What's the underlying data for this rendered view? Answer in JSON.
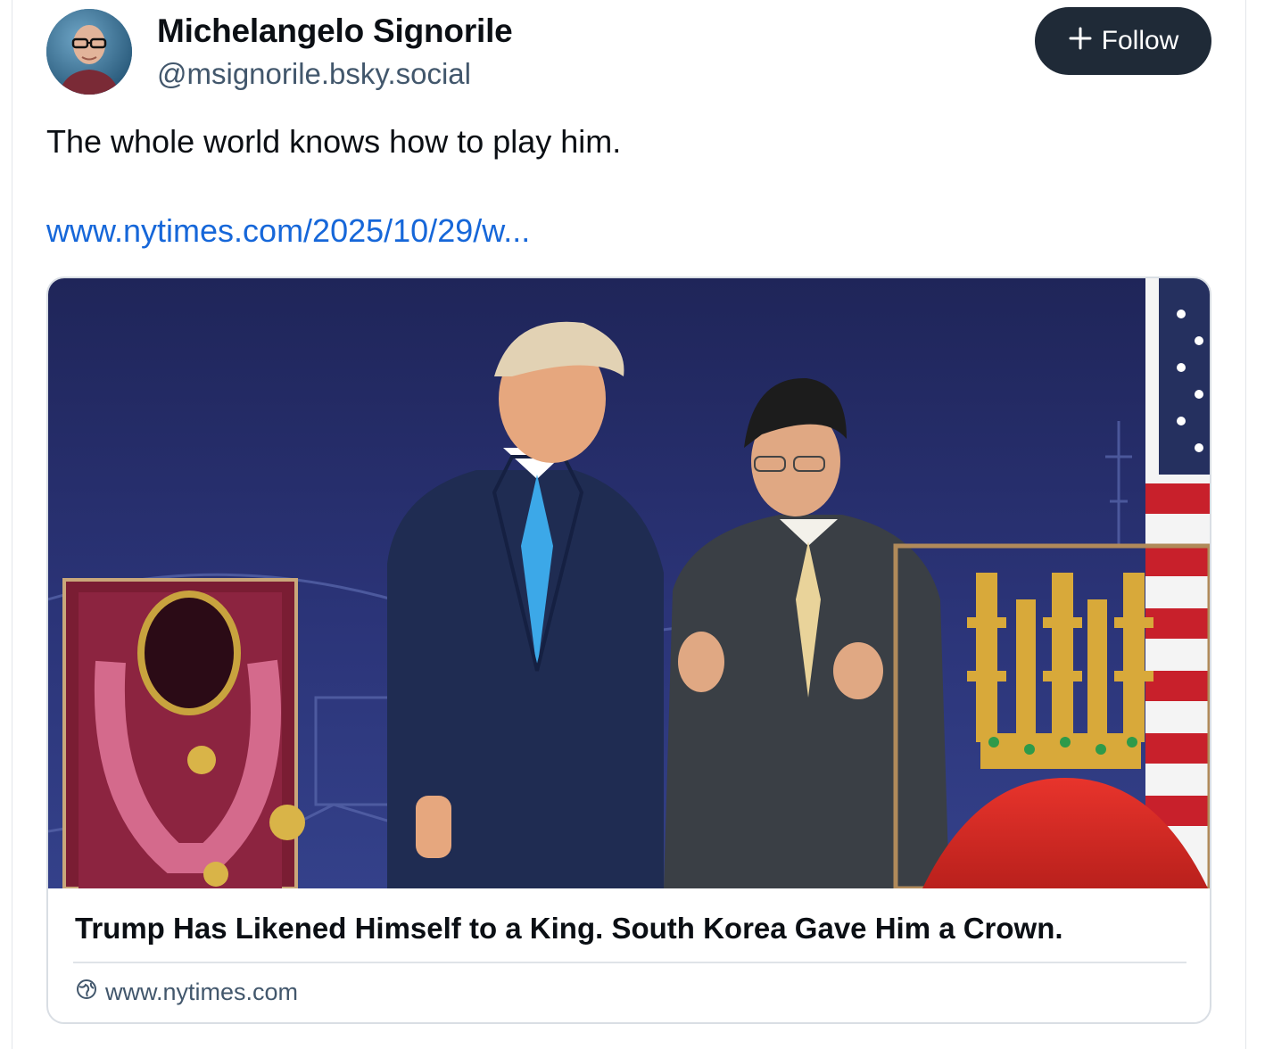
{
  "author": {
    "name": "Michelangelo Signorile",
    "handle": "@msignorile.bsky.social"
  },
  "follow_button": {
    "icon": "plus-icon",
    "label": "Follow"
  },
  "post": {
    "text": "The whole world knows how to play him.",
    "link": "www.nytimes.com/2025/10/29/w..."
  },
  "link_card": {
    "title": "Trump Has Likened Himself to a King. South Korea Gave Him a Crown.",
    "domain": "www.nytimes.com",
    "domain_icon": "globe-icon"
  },
  "colors": {
    "follow_bg": "#1f2a37",
    "link": "#1667d9",
    "muted": "#42576c"
  }
}
